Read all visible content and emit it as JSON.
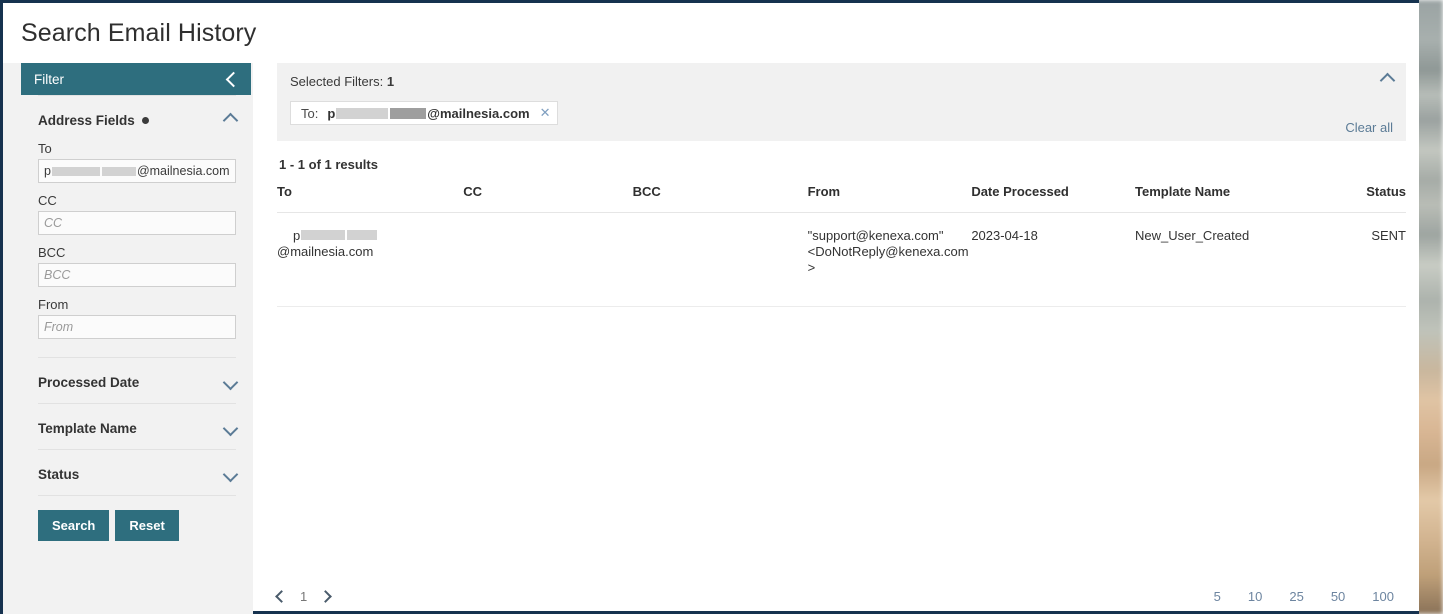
{
  "page_title": "Search Email History",
  "sidebar": {
    "header": {
      "label": "Filter",
      "collapse_icon": "chevron-left-icon"
    },
    "sections": [
      {
        "title": "Address Fields",
        "has_dot": true,
        "state": "expanded",
        "icon": "chevron-up-icon"
      },
      {
        "title": "Processed Date",
        "has_dot": false,
        "state": "collapsed",
        "icon": "chevron-down-icon"
      },
      {
        "title": "Template Name",
        "has_dot": false,
        "state": "collapsed",
        "icon": "chevron-down-icon"
      },
      {
        "title": "Status",
        "has_dot": false,
        "state": "collapsed",
        "icon": "chevron-down-icon"
      }
    ],
    "fields": [
      {
        "label": "To",
        "value_prefix": "p",
        "value_suffix": "@mailnesia.com",
        "redacted": true,
        "placeholder": "To"
      },
      {
        "label": "CC",
        "value": "",
        "placeholder": "CC"
      },
      {
        "label": "BCC",
        "value": "",
        "placeholder": "BCC"
      },
      {
        "label": "From",
        "value": "",
        "placeholder": "From"
      }
    ],
    "buttons": {
      "search": "Search",
      "reset": "Reset"
    }
  },
  "selected_filters": {
    "heading_label": "Selected Filters:",
    "count": "1",
    "collapse_icon": "chevron-up-icon",
    "chips": [
      {
        "key": "To:",
        "value_prefix": "p",
        "value_suffix": "@mailnesia.com",
        "redacted": true,
        "remove_icon": "close-icon"
      }
    ],
    "clear_all": "Clear all"
  },
  "results": {
    "count_text": "1 - 1 of 1 results",
    "columns": [
      "To",
      "CC",
      "BCC",
      "From",
      "Date Processed",
      "Template Name",
      "Status"
    ],
    "rows": [
      {
        "to_prefix": "p",
        "to_suffix": "@mailnesia.com",
        "to_redacted": true,
        "cc": "",
        "bcc": "",
        "from": "\"support@kenexa.com\" <DoNotReply@kenexa.com>",
        "date_processed": "2023-04-18",
        "template_name": "New_User_Created",
        "status": "SENT"
      }
    ]
  },
  "pagination": {
    "prev_icon": "chevron-left-icon",
    "next_icon": "chevron-right-icon",
    "current_page": "1",
    "page_sizes": [
      "5",
      "10",
      "25",
      "50",
      "100"
    ]
  },
  "colors": {
    "accent_teal": "#2e6e7e",
    "link_blue": "#5b7b96",
    "window_border": "#16324f",
    "panel_grey": "#f1f1f1"
  }
}
